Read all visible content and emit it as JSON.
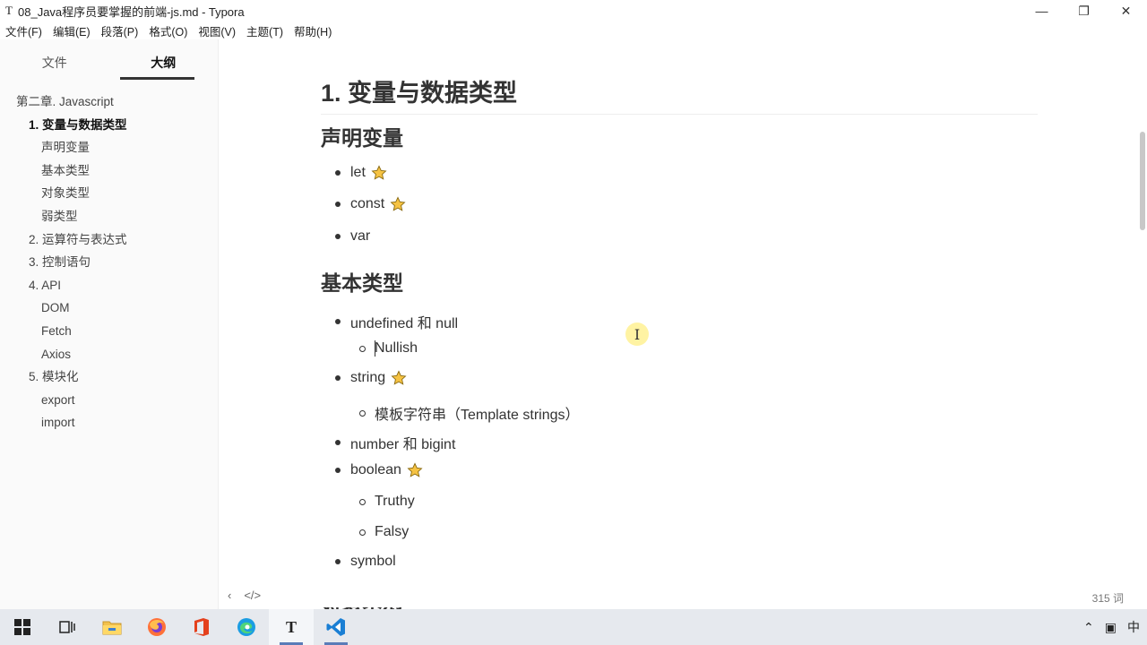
{
  "window": {
    "icon_letter": "T",
    "title": "08_Java程序员要掌握的前端-js.md - Typora",
    "controls": [
      "—",
      "❐",
      "✕"
    ]
  },
  "menu": [
    "文件(F)",
    "编辑(E)",
    "段落(P)",
    "格式(O)",
    "视图(V)",
    "主题(T)",
    "帮助(H)"
  ],
  "sidebar": {
    "tabs": [
      "文件",
      "大纲"
    ],
    "active_tab": "大纲",
    "outline": [
      {
        "label": "第二章. Javascript",
        "level": 1
      },
      {
        "label": "1. 变量与数据类型",
        "level": 2,
        "active": true
      },
      {
        "label": "声明变量",
        "level": 3
      },
      {
        "label": "基本类型",
        "level": 3
      },
      {
        "label": "对象类型",
        "level": 3
      },
      {
        "label": "弱类型",
        "level": 3
      },
      {
        "label": "2. 运算符与表达式",
        "level": 2
      },
      {
        "label": "3. 控制语句",
        "level": 2
      },
      {
        "label": "4. API",
        "level": 2
      },
      {
        "label": "DOM",
        "level": 3
      },
      {
        "label": "Fetch",
        "level": 3
      },
      {
        "label": "Axios",
        "level": 3
      },
      {
        "label": "5. 模块化",
        "level": 2
      },
      {
        "label": "export",
        "level": 3
      },
      {
        "label": "import",
        "level": 3
      }
    ]
  },
  "doc": {
    "h1": "1. 变量与数据类型",
    "h2_declare": "声明变量",
    "declare_items": [
      "let",
      "const",
      "var"
    ],
    "h2_basic": "基本类型",
    "basic": {
      "undefined_null": "undefined 和 null",
      "nullish": "Nullish",
      "string": "string",
      "template": "模板字符串（Template strings）",
      "number": "number 和 bigint",
      "boolean": "boolean",
      "truthy": "Truthy",
      "falsy": "Falsy",
      "symbol": "symbol"
    },
    "h2_object": "对象类型"
  },
  "footer": {
    "word_count": "315 词"
  },
  "taskbar": {
    "tray_ime": "中"
  },
  "colors": {
    "star_fill": "#f6c343",
    "star_stroke": "#8a6a10",
    "taskbar_bg": "#e6e9ee"
  }
}
